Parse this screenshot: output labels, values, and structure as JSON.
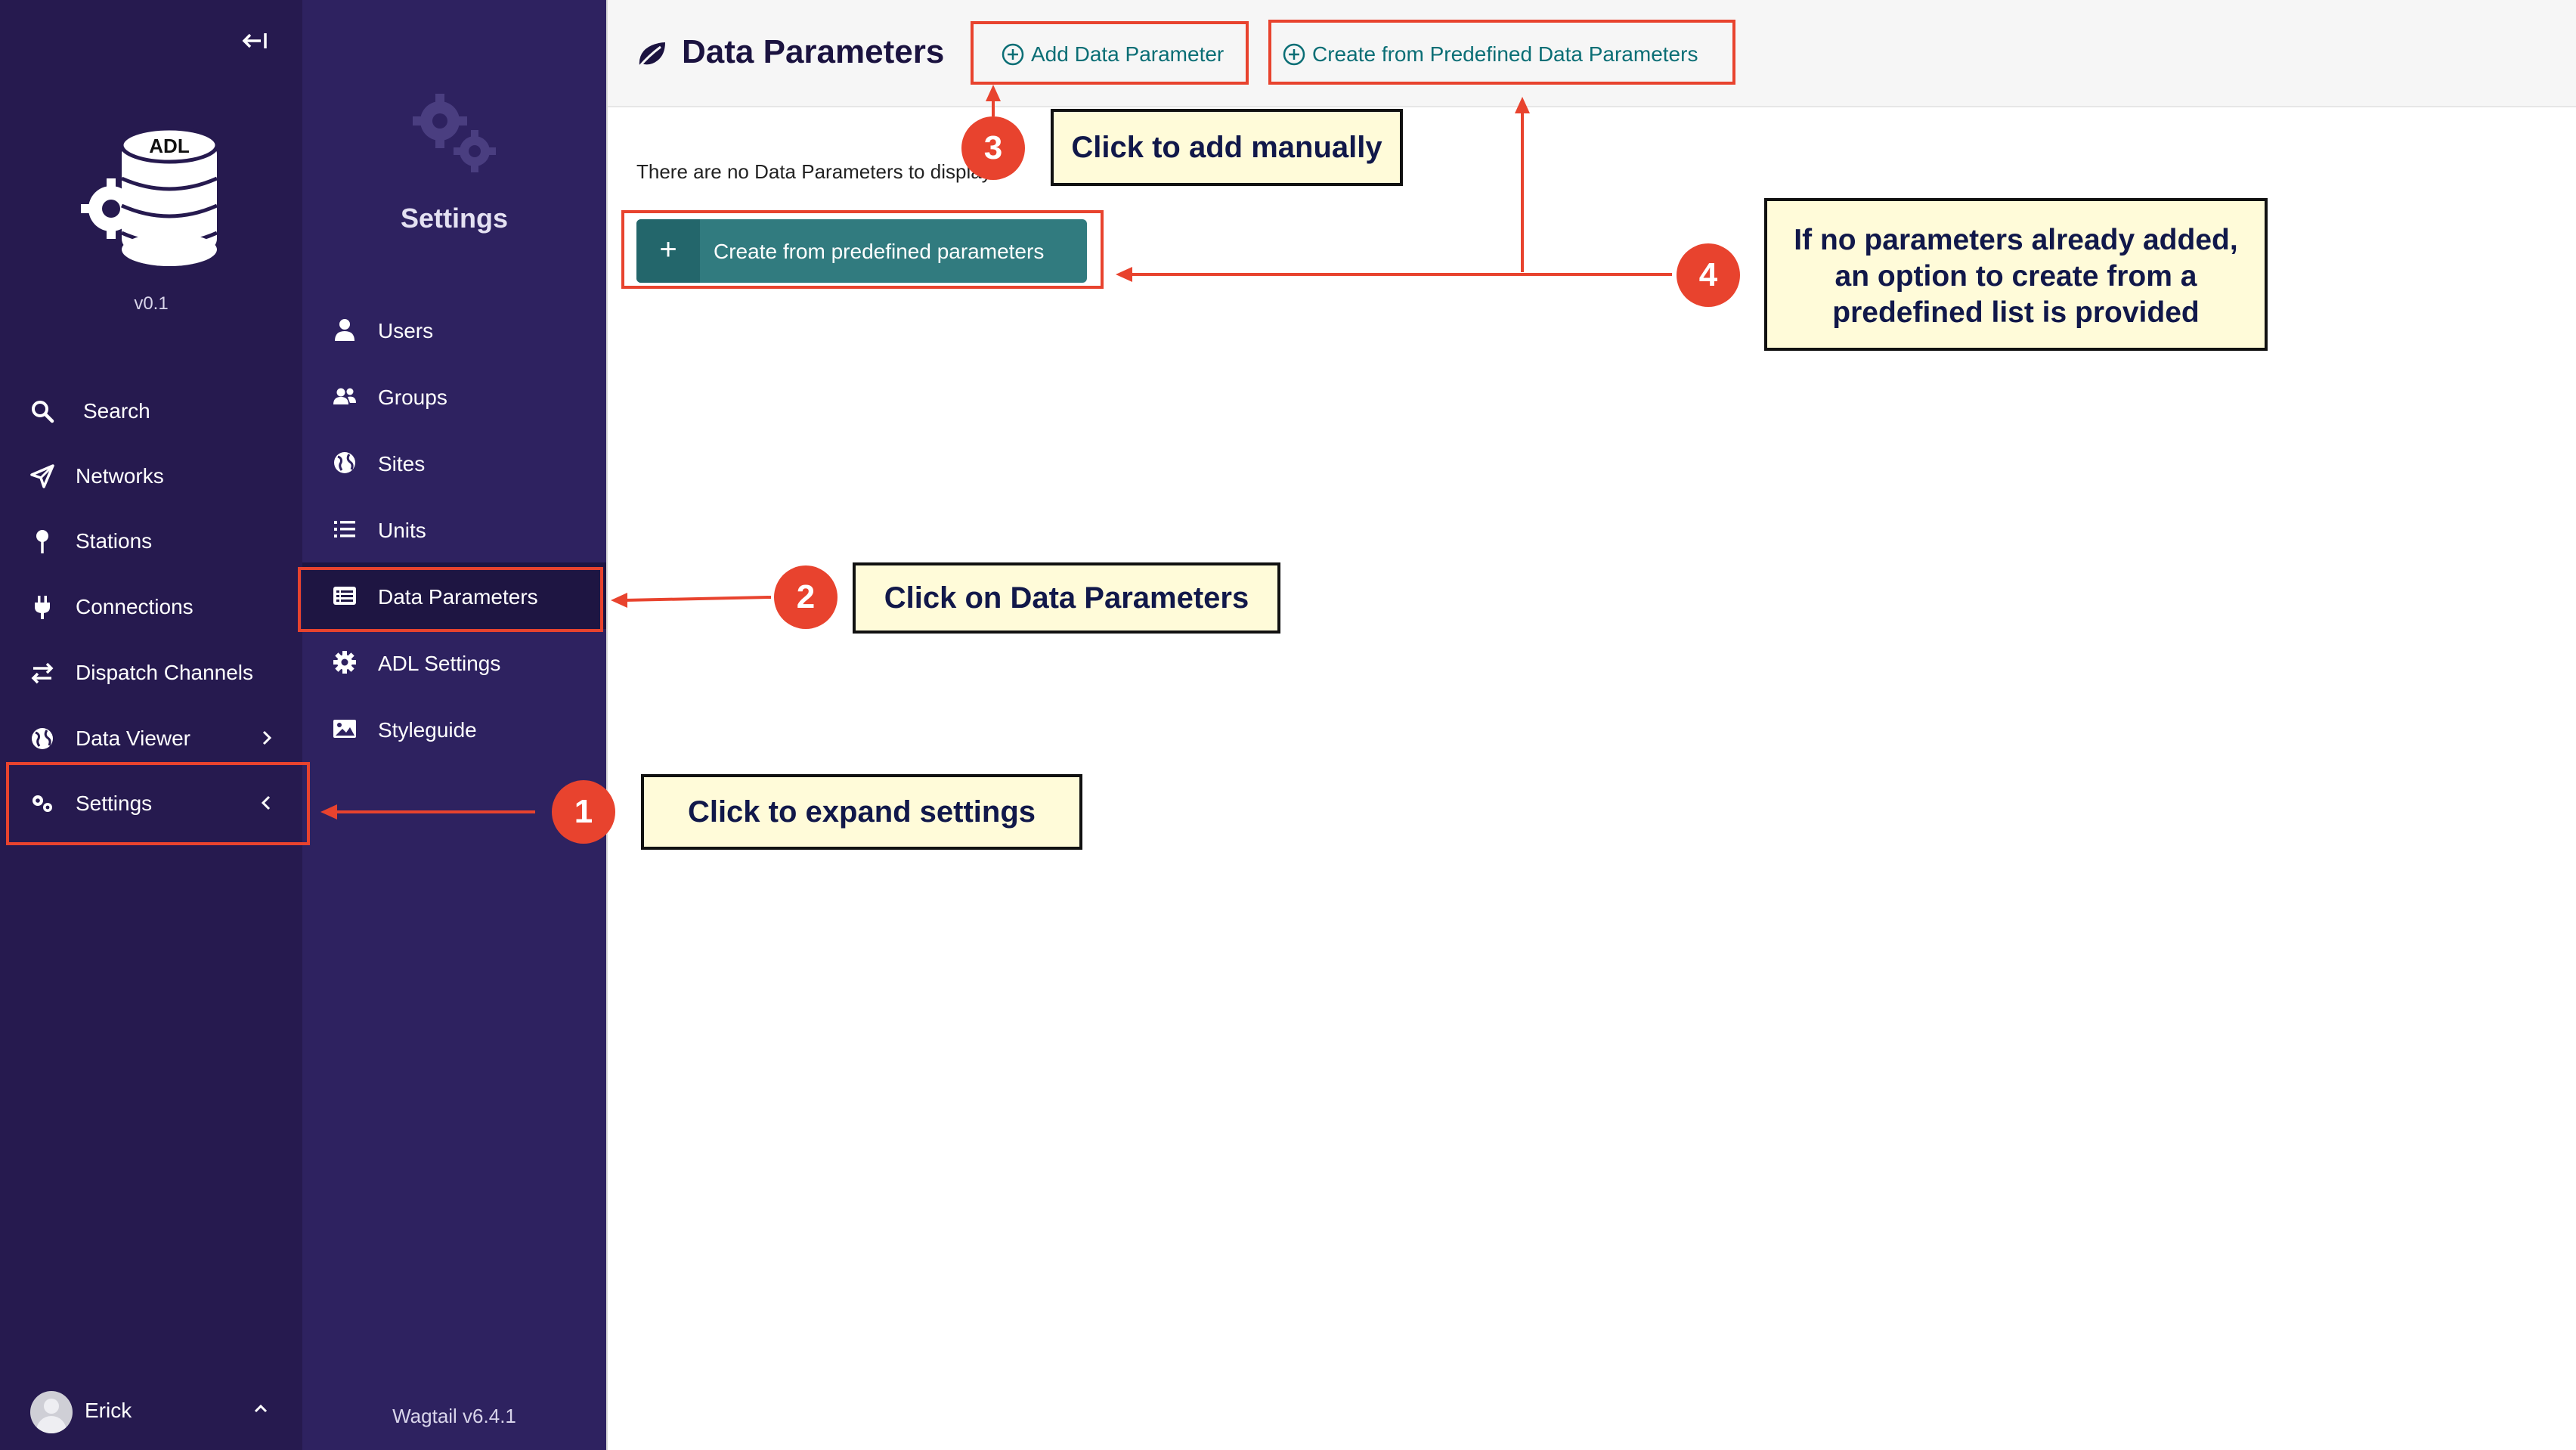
{
  "sidebar": {
    "version": "v0.1",
    "logo_text": "ADL",
    "items": [
      {
        "label": "Search",
        "icon": "search-icon"
      },
      {
        "label": "Networks",
        "icon": "send-icon"
      },
      {
        "label": "Stations",
        "icon": "pin-icon"
      },
      {
        "label": "Connections",
        "icon": "plug-icon"
      },
      {
        "label": "Dispatch Channels",
        "icon": "swap-icon"
      },
      {
        "label": "Data Viewer",
        "icon": "globe-icon"
      },
      {
        "label": "Settings",
        "icon": "cogs-icon"
      }
    ],
    "user": {
      "name": "Erick"
    }
  },
  "settings_menu": {
    "title": "Settings",
    "items": [
      {
        "label": "Users",
        "icon": "user-icon"
      },
      {
        "label": "Groups",
        "icon": "group-icon"
      },
      {
        "label": "Sites",
        "icon": "globe-icon"
      },
      {
        "label": "Units",
        "icon": "list-icon"
      },
      {
        "label": "Data Parameters",
        "icon": "table-list-icon",
        "active": true
      },
      {
        "label": "ADL Settings",
        "icon": "gear-icon"
      },
      {
        "label": "Styleguide",
        "icon": "image-icon"
      }
    ],
    "footer": "Wagtail v6.4.1"
  },
  "main": {
    "title": "Data Parameters",
    "add_button": "Add Data Parameter",
    "predefined_button": "Create from Predefined Data Parameters",
    "empty_message": "There are no Data Parameters to display.",
    "create_button": "Create from predefined parameters"
  },
  "annotations": {
    "badges": [
      "1",
      "2",
      "3",
      "4"
    ],
    "callouts": {
      "expand_settings": "Click to expand settings",
      "data_parameters": "Click on Data Parameters",
      "add_manually": "Click to add manually",
      "predefined": [
        "If no parameters already added,",
        "an option to create from a",
        "predefined list is provided"
      ]
    }
  },
  "colors": {
    "sidebar_bg": "#261a4f",
    "submenu_bg": "#2e2260",
    "accent_teal": "#317b7f",
    "annotation_red": "#e8432e",
    "callout_bg": "#fffbd9"
  }
}
